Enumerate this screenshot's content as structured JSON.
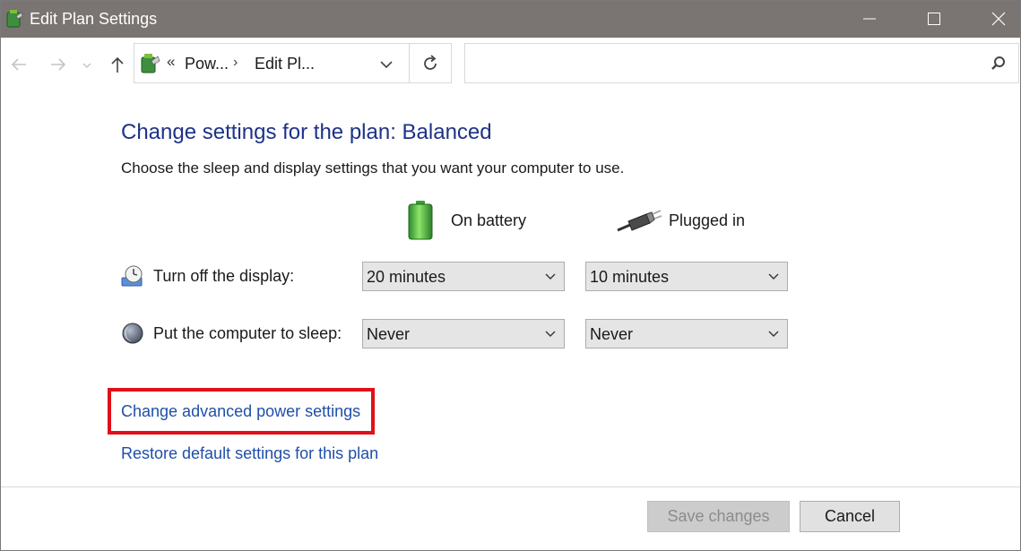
{
  "window": {
    "title": "Edit Plan Settings"
  },
  "nav": {
    "breadcrumb_chevron": "«",
    "crumb1": "Pow...",
    "separator": "›",
    "crumb2": "Edit Pl...",
    "search_placeholder": ""
  },
  "content": {
    "heading": "Change settings for the plan: Balanced",
    "description": "Choose the sleep and display settings that you want your computer to use.",
    "columns": {
      "battery": "On battery",
      "plugged": "Plugged in"
    },
    "rows": [
      {
        "label": "Turn off the display:",
        "battery": "20 minutes",
        "plugged": "10 minutes"
      },
      {
        "label": "Put the computer to sleep:",
        "battery": "Never",
        "plugged": "Never"
      }
    ],
    "links": {
      "advanced": "Change advanced power settings",
      "restore": "Restore default settings for this plan"
    }
  },
  "footer": {
    "save": "Save changes",
    "cancel": "Cancel"
  },
  "colors": {
    "heading": "#1e3287",
    "link": "#1f4fa8",
    "highlight": "#e0101a",
    "titlebar": "#7a7472"
  }
}
